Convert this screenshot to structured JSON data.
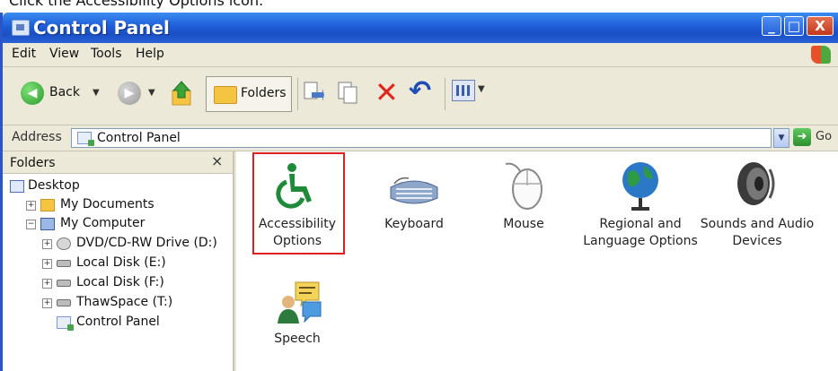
{
  "caption": "Click the Accessibility Options icon.",
  "window": {
    "title": "Control Panel",
    "controls": {
      "minimize": "_",
      "maximize": "□",
      "close": "X"
    }
  },
  "menu": [
    "Edit",
    "View",
    "Tools",
    "Help"
  ],
  "toolbar": {
    "back_label": "Back",
    "folders_label": "Folders"
  },
  "address": {
    "label": "Address",
    "value": "Control Panel",
    "go_label": "Go"
  },
  "folders_pane": {
    "title": "Folders",
    "close_glyph": "×",
    "tree": [
      {
        "label": "Desktop",
        "expander": ""
      },
      {
        "label": "My Documents",
        "expander": "+"
      },
      {
        "label": "My Computer",
        "expander": "−"
      },
      {
        "label": "DVD/CD-RW Drive (D:)",
        "expander": "+"
      },
      {
        "label": "Local Disk (E:)",
        "expander": "+"
      },
      {
        "label": "Local Disk (F:)",
        "expander": "+"
      },
      {
        "label": "ThawSpace (T:)",
        "expander": "+"
      },
      {
        "label": "Control Panel",
        "expander": ""
      }
    ]
  },
  "items": [
    {
      "label_line1": "Accessibility",
      "label_line2": "Options",
      "icon": "wheelchair-icon",
      "color": "#1f8a3a"
    },
    {
      "label_line1": "Keyboard",
      "label_line2": "",
      "icon": "keyboard-icon"
    },
    {
      "label_line1": "Mouse",
      "label_line2": "",
      "icon": "mouse-icon"
    },
    {
      "label_line1": "Regional and",
      "label_line2": "Language Options",
      "icon": "globe-icon"
    },
    {
      "label_line1": "Sounds and Audio",
      "label_line2": "Devices",
      "icon": "speaker-icon"
    },
    {
      "label_line1": "Speech",
      "label_line2": "",
      "icon": "speech-icon"
    }
  ],
  "highlight_color": "#e02020"
}
